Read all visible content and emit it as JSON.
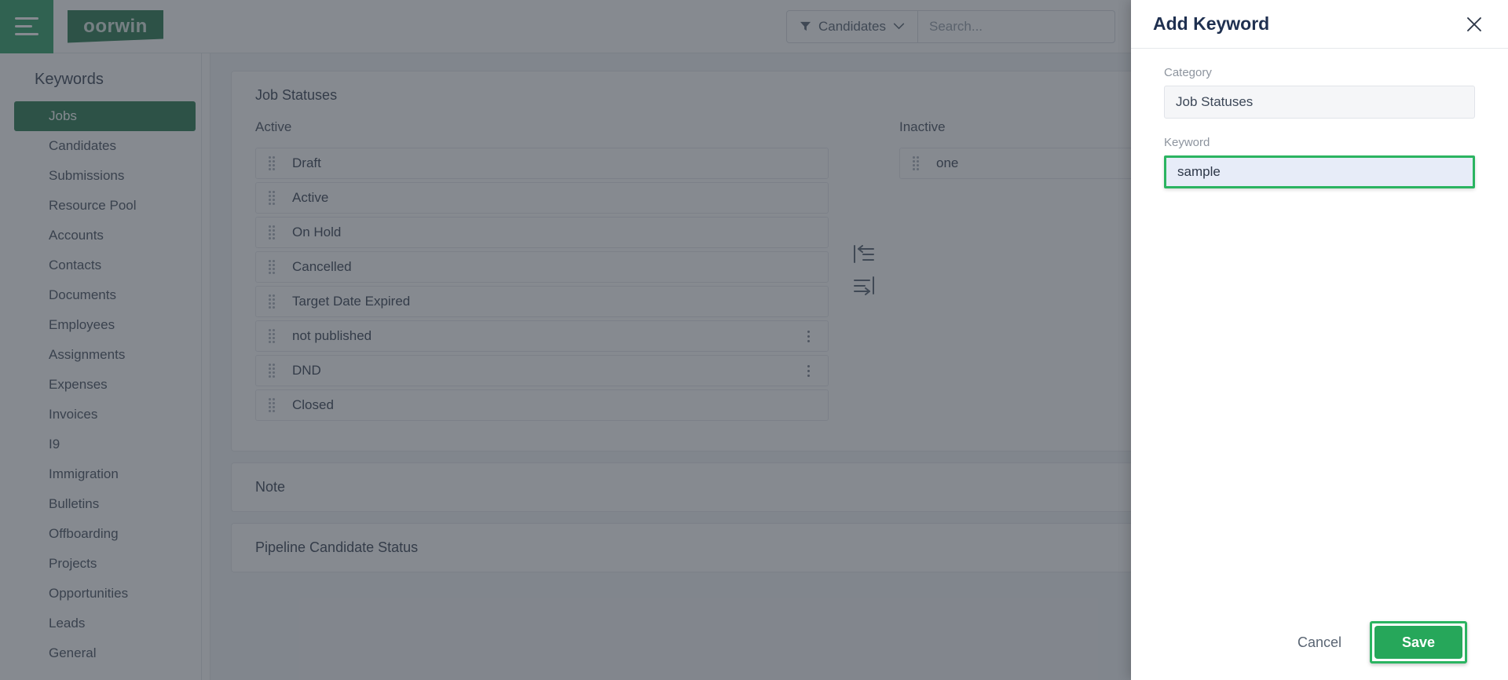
{
  "header": {
    "menu_icon": "hamburger-icon",
    "brand": "oorwin",
    "filter": {
      "icon": "funnel-icon",
      "label": "Candidates",
      "caret_icon": "chevron-down-icon"
    },
    "search": {
      "placeholder": "Search...",
      "value": ""
    }
  },
  "sidebar": {
    "title": "Keywords",
    "items": [
      {
        "label": "Jobs",
        "active": true
      },
      {
        "label": "Candidates",
        "active": false
      },
      {
        "label": "Submissions",
        "active": false
      },
      {
        "label": "Resource Pool",
        "active": false
      },
      {
        "label": "Accounts",
        "active": false
      },
      {
        "label": "Contacts",
        "active": false
      },
      {
        "label": "Documents",
        "active": false
      },
      {
        "label": "Employees",
        "active": false
      },
      {
        "label": "Assignments",
        "active": false
      },
      {
        "label": "Expenses",
        "active": false
      },
      {
        "label": "Invoices",
        "active": false
      },
      {
        "label": "I9",
        "active": false
      },
      {
        "label": "Immigration",
        "active": false
      },
      {
        "label": "Bulletins",
        "active": false
      },
      {
        "label": "Offboarding",
        "active": false
      },
      {
        "label": "Projects",
        "active": false
      },
      {
        "label": "Opportunities",
        "active": false
      },
      {
        "label": "Leads",
        "active": false
      },
      {
        "label": "General",
        "active": false
      }
    ]
  },
  "main": {
    "panels": [
      {
        "title": "Job Statuses",
        "expanded": true
      },
      {
        "title": "Note",
        "expanded": false
      },
      {
        "title": "Pipeline Candidate Status",
        "expanded": false
      }
    ],
    "job_statuses": {
      "active_header": "Active",
      "inactive_header": "Inactive",
      "active_items": [
        {
          "label": "Draft",
          "has_menu": false
        },
        {
          "label": "Active",
          "has_menu": false
        },
        {
          "label": "On Hold",
          "has_menu": false
        },
        {
          "label": "Cancelled",
          "has_menu": false
        },
        {
          "label": "Target Date Expired",
          "has_menu": false
        },
        {
          "label": "not published",
          "has_menu": true
        },
        {
          "label": "DND",
          "has_menu": true
        },
        {
          "label": "Closed",
          "has_menu": false
        }
      ],
      "inactive_items": [
        {
          "label": "one",
          "has_menu": false
        }
      ],
      "transfer_icons": [
        "move-to-left-icon",
        "move-to-right-icon"
      ]
    }
  },
  "modal": {
    "title": "Add Keyword",
    "close_icon": "close-icon",
    "category": {
      "label": "Category",
      "value": "Job Statuses",
      "placeholder": "Category"
    },
    "keyword": {
      "label": "Keyword",
      "value": "sample",
      "placeholder": "Keyword"
    },
    "cancel_label": "Cancel",
    "save_label": "Save"
  },
  "colors": {
    "brand_green": "#2d7a52",
    "accent_green": "#34a06a",
    "save_green": "#26a75a",
    "focus_green": "#2bb461",
    "focus_fill": "#e7ecf8",
    "text_dark": "#3c4757",
    "text_muted": "#8d949e",
    "dim_overlay": "rgba(47,54,64,0.58)"
  }
}
